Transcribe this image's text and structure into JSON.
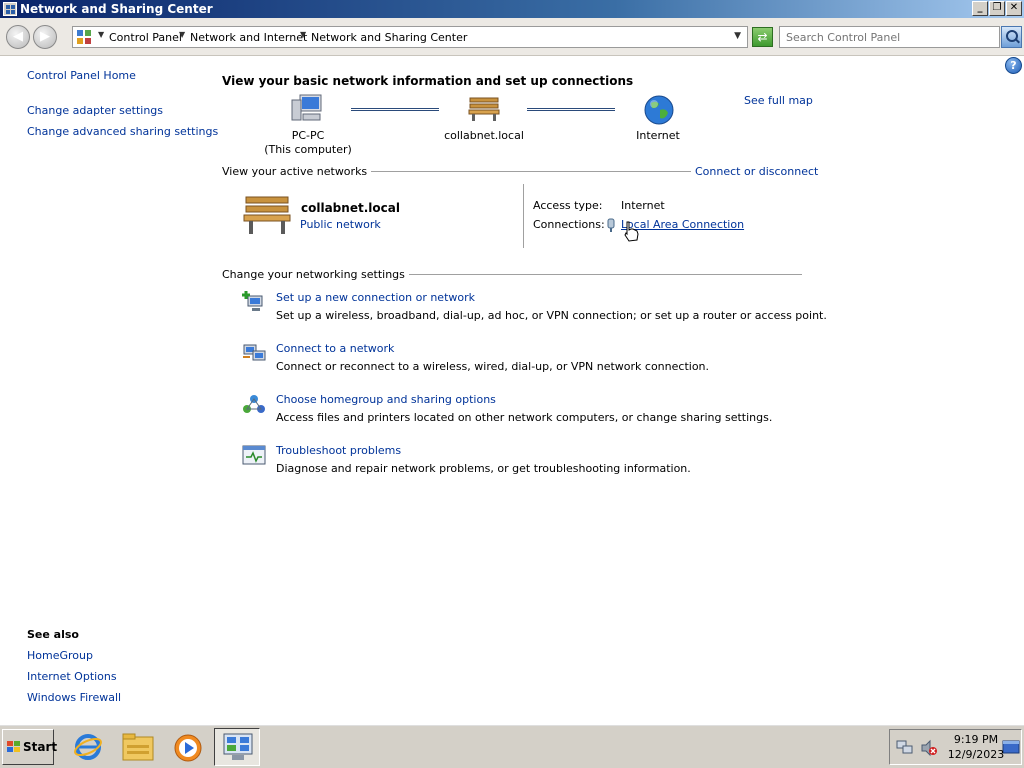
{
  "window": {
    "title": "Network and Sharing Center",
    "buttons": {
      "minimize": "_",
      "maximize": "❐",
      "close": "✕"
    }
  },
  "address": {
    "crumbs": [
      "Control Panel",
      "Network and Internet",
      "Network and Sharing Center"
    ],
    "search_placeholder": "Search Control Panel"
  },
  "sidebar": {
    "home": "Control Panel Home",
    "items": [
      "Change adapter settings",
      "Change advanced sharing settings"
    ],
    "see_also_title": "See also",
    "see_also": [
      "HomeGroup",
      "Internet Options",
      "Windows Firewall"
    ]
  },
  "main": {
    "heading": "View your basic network information and set up connections",
    "map": {
      "computer": "PC-PC",
      "computer_sub": "(This computer)",
      "network": "collabnet.local",
      "internet": "Internet",
      "see_full_map": "See full map"
    },
    "active": {
      "label": "View your active networks",
      "connect_link": "Connect or disconnect",
      "network_name": "collabnet.local",
      "network_type": "Public network",
      "access_type_label": "Access type:",
      "access_type_value": "Internet",
      "connections_label": "Connections:",
      "connections_value": "Local Area Connection"
    },
    "settings": {
      "label": "Change your networking settings",
      "tasks": [
        {
          "title": "Set up a new connection or network",
          "desc": "Set up a wireless, broadband, dial-up, ad hoc, or VPN connection; or set up a router or access point."
        },
        {
          "title": "Connect to a network",
          "desc": "Connect or reconnect to a wireless, wired, dial-up, or VPN network connection."
        },
        {
          "title": "Choose homegroup and sharing options",
          "desc": "Access files and printers located on other network computers, or change sharing settings."
        },
        {
          "title": "Troubleshoot problems",
          "desc": "Diagnose and repair network problems, or get troubleshooting information."
        }
      ]
    }
  },
  "taskbar": {
    "start": "Start",
    "time": "9:19 PM",
    "date": "12/9/2023"
  },
  "colors": {
    "link": "#003399",
    "titlebar": "#0a246a",
    "taskbar": "#d4d0c8"
  }
}
